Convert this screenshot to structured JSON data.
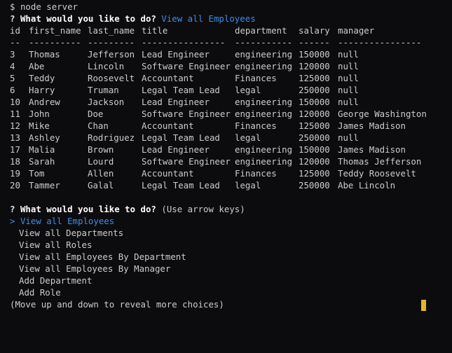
{
  "prompt_line": {
    "symbol": "$",
    "command": "node server"
  },
  "question1": {
    "mark": "?",
    "text": "What would you like to do?",
    "answer": "View all Employees"
  },
  "table": {
    "headers": [
      "id",
      "first_name",
      "last_name",
      "title",
      "department",
      "salary",
      "manager"
    ],
    "separators": [
      "--",
      "----------",
      "---------",
      "----------------",
      "-----------",
      "------",
      "----------------"
    ],
    "rows": [
      [
        "3",
        "Thomas",
        "Jefferson",
        "Lead Engineer",
        "engineering",
        "150000",
        "null"
      ],
      [
        "4",
        "Abe",
        "Lincoln",
        "Software Engineer",
        "engineering",
        "120000",
        "null"
      ],
      [
        "5",
        "Teddy",
        "Roosevelt",
        "Accountant",
        "Finances",
        "125000",
        "null"
      ],
      [
        "6",
        "Harry",
        "Truman",
        "Legal Team Lead",
        "legal",
        "250000",
        "null"
      ],
      [
        "10",
        "Andrew",
        "Jackson",
        "Lead Engineer",
        "engineering",
        "150000",
        "null"
      ],
      [
        "11",
        "John",
        "Doe",
        "Software Engineer",
        "engineering",
        "120000",
        "George Washington"
      ],
      [
        "12",
        "Mike",
        "Chan",
        "Accountant",
        "Finances",
        "125000",
        "James Madison"
      ],
      [
        "13",
        "Ashley",
        "Rodriguez",
        "Legal Team Lead",
        "legal",
        "250000",
        "null"
      ],
      [
        "17",
        "Malia",
        "Brown",
        "Lead Engineer",
        "engineering",
        "150000",
        "James Madison"
      ],
      [
        "18",
        "Sarah",
        "Lourd",
        "Software Engineer",
        "engineering",
        "120000",
        "Thomas Jefferson"
      ],
      [
        "19",
        "Tom",
        "Allen",
        "Accountant",
        "Finances",
        "125000",
        "Teddy Roosevelt"
      ],
      [
        "20",
        "Tammer",
        "Galal",
        "Legal Team Lead",
        "legal",
        "250000",
        "Abe Lincoln"
      ]
    ]
  },
  "question2": {
    "mark": "?",
    "text": "What would you like to do?",
    "hint": "(Use arrow keys)",
    "pointer": ">",
    "choices": [
      "View all Employees",
      "View all Departments",
      "View all Roles",
      "View all Employees By Department",
      "View all Employees By Manager",
      "Add Department",
      "Add Role"
    ],
    "footer": "(Move up and down to reveal more choices)"
  },
  "colors": {
    "background": "#0c0c0f",
    "text": "#cccccc",
    "accent": "#3b8eea",
    "cursor": "#e5b334"
  }
}
